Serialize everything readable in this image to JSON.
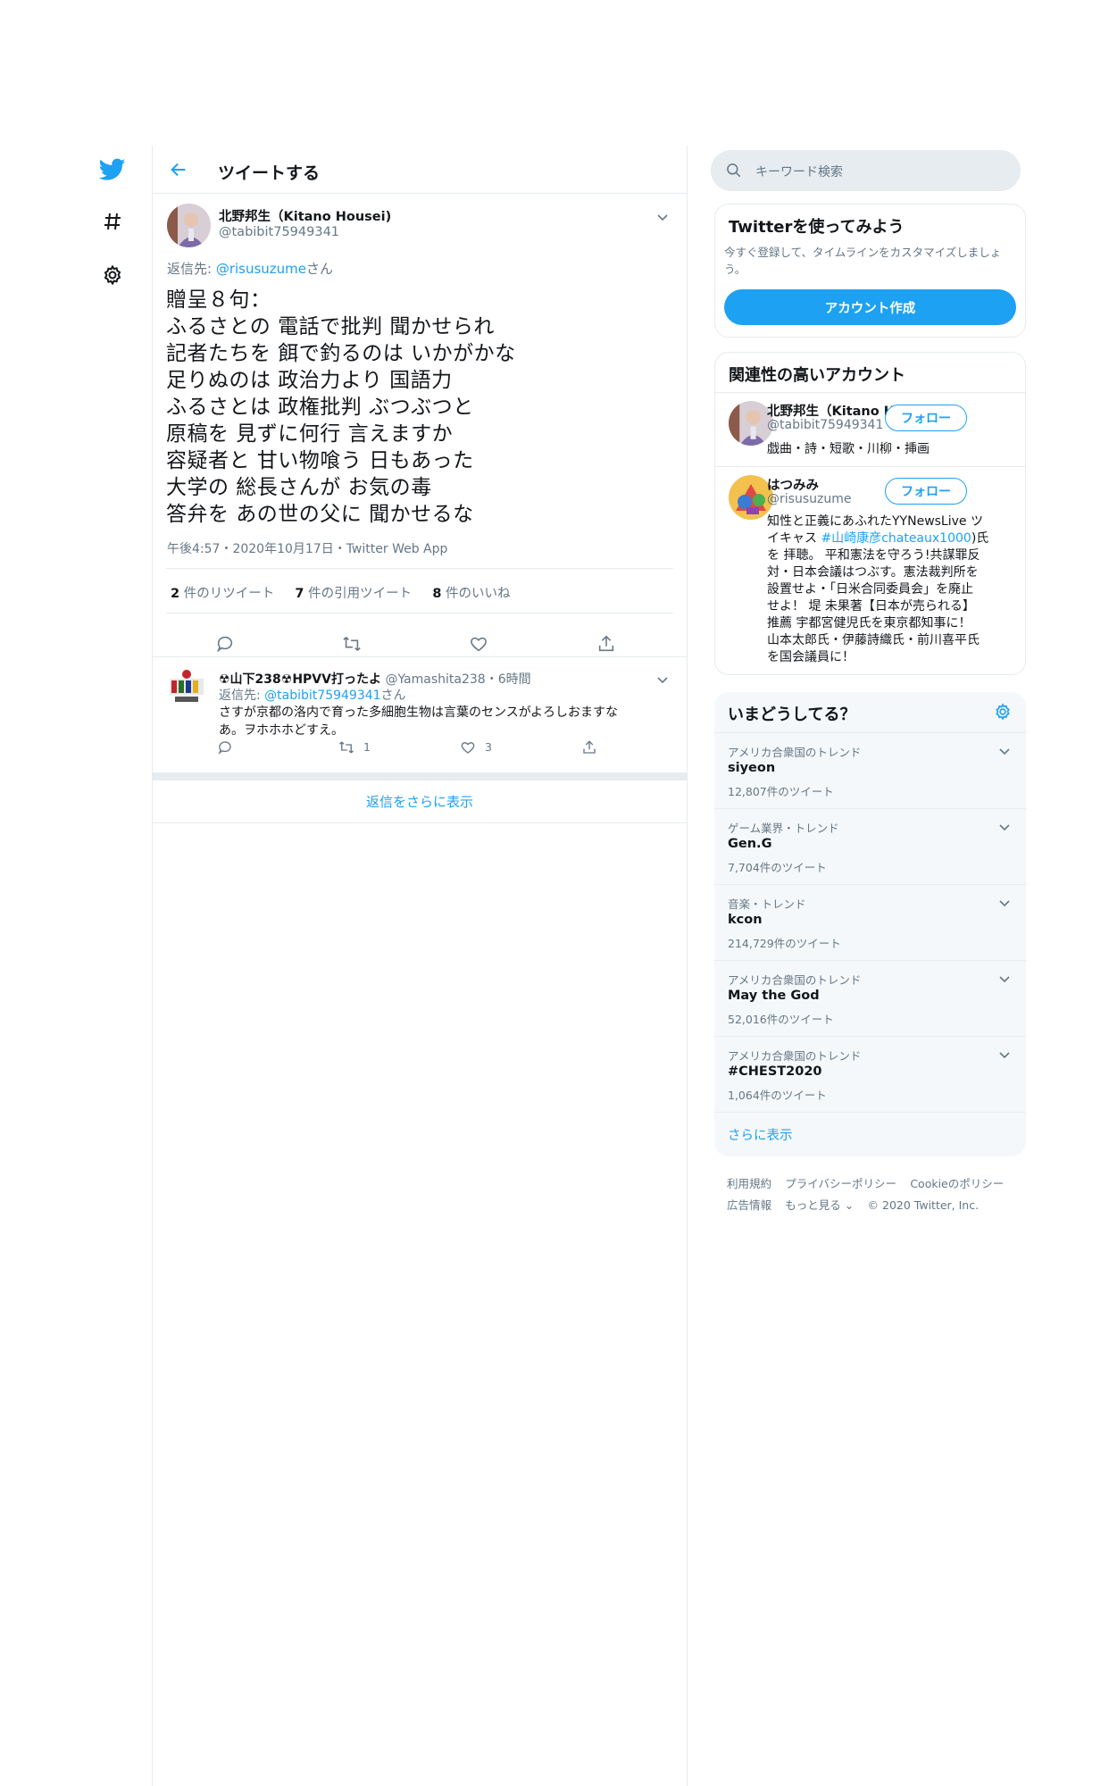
{
  "nav": {
    "logo": "twitter-bird-icon",
    "explore": "hashtag-icon",
    "settings": "gear-icon"
  },
  "header": {
    "title": "ツイートする",
    "back_icon": "arrow-left-icon"
  },
  "tweet": {
    "author_name": "北野邦生（Kitano Housei)",
    "author_handle": "@tabibit75949341",
    "reply_to_prefix": "返信先: ",
    "reply_to_handle": "@risusuzume",
    "reply_to_suffix": "さん",
    "lines": [
      "贈呈８句：",
      "ふるさとの 電話で批判 聞かせられ",
      "記者たちを 餌で釣るのは いかがかな",
      "足りぬのは 政治力より 国語力",
      "ふるさとは 政権批判 ぶつぶつと",
      "原稿を 見ずに何行 言えますか",
      "容疑者と 甘い物喰う 日もあった",
      "大学の 総長さんが お気の毒",
      "答弁を あの世の父に 聞かせるな"
    ],
    "meta": "午後4:57・2020年10月17日・Twitter Web App",
    "stats": {
      "retweets_count": "2",
      "retweets_label": " 件のリツイート",
      "quotes_count": "7",
      "quotes_label": " 件の引用ツイート",
      "likes_count": "8",
      "likes_label": " 件のいいね"
    }
  },
  "reply": {
    "name": "☢山下238☢HPVV打ったよ",
    "handle": "@Yamashita238",
    "time": "・6時間",
    "reply_to_prefix": "返信先: ",
    "reply_to_handle": "@tabibit75949341",
    "reply_to_suffix": "さん",
    "text_line1": "さすが京都の洛内で育った多細胞生物は言葉のセンスがよろしおますな",
    "text_line2": "あ。ヲホホホどすえ。",
    "retweets": "1",
    "likes": "3"
  },
  "show_more_replies": "返信をさらに表示",
  "search": {
    "placeholder": "キーワード検索"
  },
  "signup": {
    "title": "Twitterを使ってみよう",
    "desc_line1": "今すぐ登録して、タイムラインをカスタマイズしましょ",
    "desc_line2": "う。",
    "button": "アカウント作成"
  },
  "related": {
    "title": "関連性の高いアカウント",
    "follow_label": "フォロー",
    "accounts": [
      {
        "name": "北野邦生（Kitano Ho...",
        "handle": "@tabibit75949341",
        "bio_lines": [
          "戯曲・詩・短歌・川柳・挿画"
        ]
      },
      {
        "name": "はつみみ",
        "handle": "@risusuzume",
        "bio_lines": [
          "知性と正義にあふれたYYNewsLive ツ",
          "イキャス ",
          "#山崎康彦chateaux1000",
          ")氏",
          "を 拝聴。 平和憲法を守ろう!共謀罪反",
          "対・日本会議はつぶす。憲法裁判所を",
          "設置せよ・「日米合同委員会」を廃止",
          "せよ！ 堤 未果著【日本が売られる】",
          "推薦 宇都宮健児氏を東京都知事に！",
          "山本太郎氏・伊藤詩織氏・前川喜平氏",
          "を国会議員に！"
        ]
      }
    ]
  },
  "trends": {
    "title": "いまどうしてる？",
    "items": [
      {
        "context": "アメリカ合衆国のトレンド",
        "name": "siyeon",
        "count": "12,807件のツイート"
      },
      {
        "context": "ゲーム業界・トレンド",
        "name": "Gen.G",
        "count": "7,704件のツイート"
      },
      {
        "context": "音楽・トレンド",
        "name": "kcon",
        "count": "214,729件のツイート"
      },
      {
        "context": "アメリカ合衆国のトレンド",
        "name": "May the God",
        "count": "52,016件のツイート"
      },
      {
        "context": "アメリカ合衆国のトレンド",
        "name": "#CHEST2020",
        "count": "1,064件のツイート"
      }
    ],
    "show_more": "さらに表示"
  },
  "footer": {
    "terms": "利用規約",
    "privacy": "プライバシーポリシー",
    "cookies": "Cookieのポリシー",
    "ads": "広告情報",
    "more": "もっと見る",
    "copyright": "© 2020 Twitter, Inc."
  },
  "colors": {
    "accent": "#1da1f2",
    "text": "#14171a",
    "muted": "#657786",
    "border": "#e6ecf0",
    "panel": "#f5f8fa"
  }
}
